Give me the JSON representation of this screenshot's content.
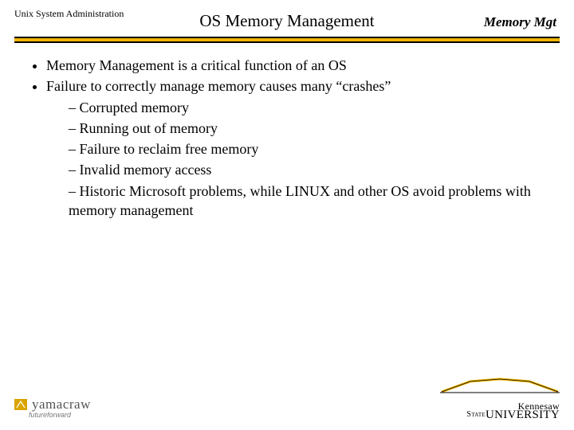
{
  "header": {
    "course_label": "Unix System Administration",
    "slide_title": "OS Memory Management",
    "topic_label": "Memory Mgt"
  },
  "bullets": {
    "b1": "Memory Management is a critical function of an OS",
    "b2": "Failure to correctly manage memory causes many “crashes”",
    "s1": "Corrupted memory",
    "s2": "Running out of memory",
    "s3": "Failure to reclaim free memory",
    "s4": "Invalid memory access",
    "s5": "Historic Microsoft problems, while LINUX and other OS avoid problems with memory management"
  },
  "footer": {
    "left_logo_main": "yamacraw",
    "left_logo_sub": "futureforward",
    "right_logo_top": "Kennesaw",
    "right_logo_state": "State",
    "right_logo_univ": "UNIVERSITY"
  },
  "colors": {
    "gold": "#f2b500",
    "black": "#000000"
  }
}
